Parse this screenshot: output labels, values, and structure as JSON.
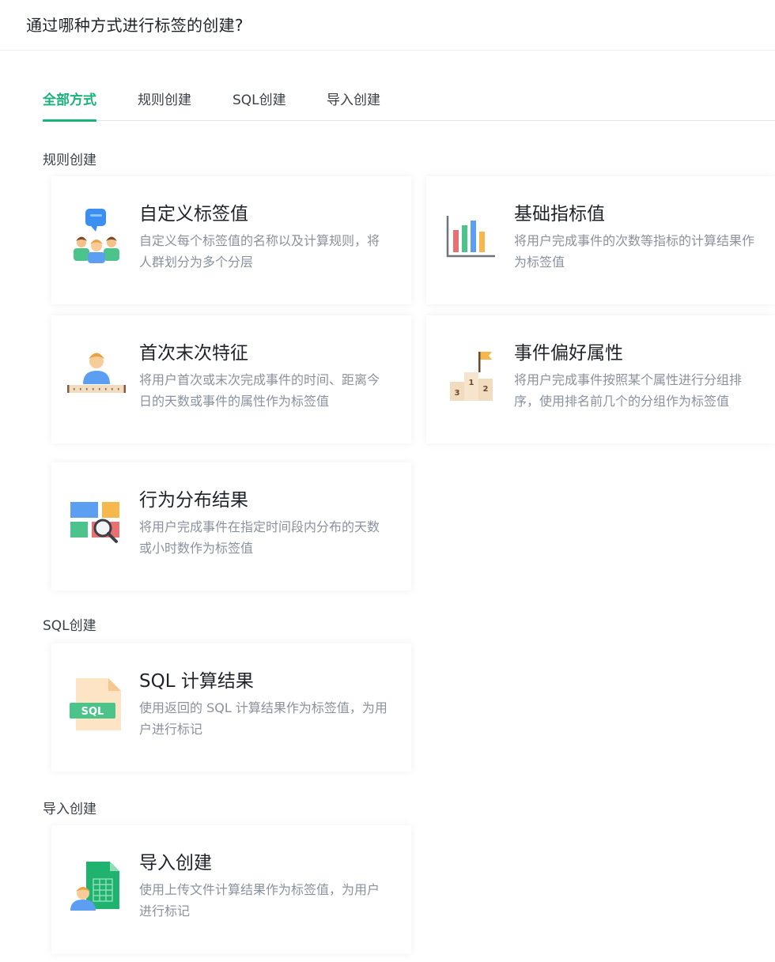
{
  "header": {
    "title": "通过哪种方式进行标签的创建?"
  },
  "tabs": [
    {
      "label": "全部方式",
      "active": true
    },
    {
      "label": "规则创建",
      "active": false
    },
    {
      "label": "SQL创建",
      "active": false
    },
    {
      "label": "导入创建",
      "active": false
    }
  ],
  "sections": {
    "rule": {
      "title": "规则创建",
      "cards": [
        {
          "title": "自定义标签值",
          "desc": "自定义每个标签值的名称以及计算规则，将人群划分为多个分层",
          "icon": "people-group-icon"
        },
        {
          "title": "基础指标值",
          "desc": "将用户完成事件的次数等指标的计算结果作为标签值",
          "icon": "bar-chart-icon"
        },
        {
          "title": "首次末次特征",
          "desc": "将用户首次或末次完成事件的时间、距离今日的天数或事件的属性作为标签值",
          "icon": "person-ruler-icon"
        },
        {
          "title": "事件偏好属性",
          "desc": "将用户完成事件按照某个属性进行分组排序，使用排名前几个的分组作为标签值",
          "icon": "podium-flag-icon"
        },
        {
          "title": "行为分布结果",
          "desc": "将用户完成事件在指定时间段内分布的天数或小时数作为标签值",
          "icon": "distribution-search-icon"
        }
      ]
    },
    "sql": {
      "title": "SQL创建",
      "cards": [
        {
          "title": "SQL 计算结果",
          "desc": "使用返回的 SQL 计算结果作为标签值，为用户进行标记",
          "icon": "sql-file-icon",
          "badge": "SQL"
        }
      ]
    },
    "import": {
      "title": "导入创建",
      "cards": [
        {
          "title": "导入创建",
          "desc": "使用上传文件计算结果作为标签值，为用户进行标记",
          "icon": "import-file-icon"
        }
      ]
    }
  },
  "podium_numbers": [
    "3",
    "1",
    "2"
  ],
  "colors": {
    "accent": "#19b37a",
    "title_text": "#1f2329",
    "desc_text": "#8a929e",
    "divider": "#e3e6ea"
  }
}
